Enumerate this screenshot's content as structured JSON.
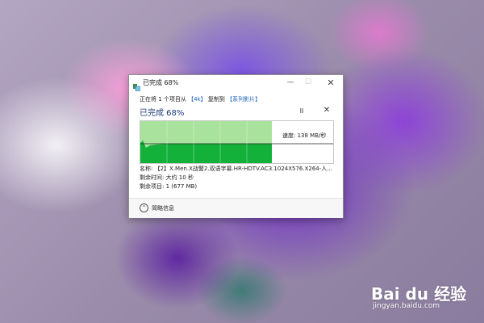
{
  "window": {
    "title": "已完成 68%",
    "minimize_glyph": "—",
    "maximize_glyph": "☐",
    "close_glyph": "✕"
  },
  "operation": {
    "prefix": "正在将 1 个项目从",
    "source": "【4k】",
    "middle": "复制到",
    "destination": "【系列影片】"
  },
  "progress": {
    "title": "已完成 68%",
    "percent": 68,
    "pause_glyph": "II",
    "cancel_glyph": "✕",
    "speed_label": "速度: 138 MB/秒"
  },
  "details": {
    "name": "名称: 【2】X.Men.X战警2.双语字幕.HR-HDTV.AC3.1024X576.X264-人...",
    "time_remaining": "剩余时间: 大约 10 秒",
    "items_remaining": "剩余项目: 1 (677 MB)"
  },
  "footer": {
    "less_details_label": "简略信息",
    "chevron_glyph": "^"
  },
  "watermark": {
    "logo_text": "Bai du 经验",
    "url": "jingyan.baidu.com"
  },
  "colors": {
    "progress_fill_light": "#a8e29c",
    "progress_fill_dark": "#13b13a",
    "link_blue": "#1a63b8"
  }
}
